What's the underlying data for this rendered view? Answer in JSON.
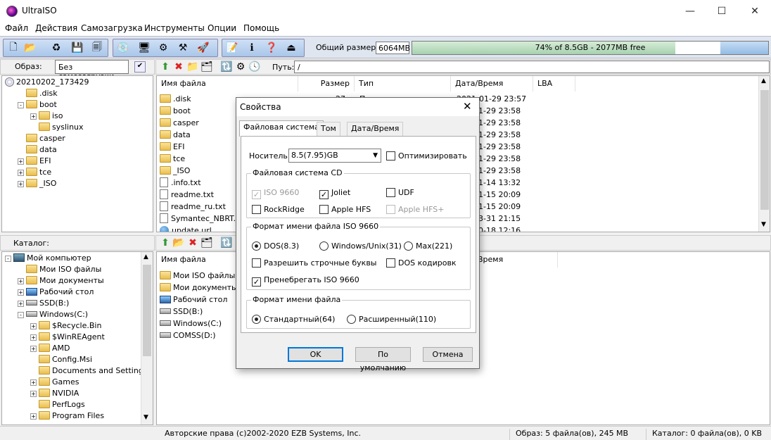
{
  "window": {
    "title": "UltraISO",
    "min": "—",
    "max": "☐",
    "close": "✕"
  },
  "menu": [
    "Файл",
    "Действия",
    "Самозагрузка",
    "Инструменты",
    "Опции",
    "Помощь"
  ],
  "toolbar": {
    "size_label": "Общий размер:",
    "size_value": "6064MB",
    "capacity_text": "74% of 8.5GB - 2077MB free",
    "used_fraction": 0.74
  },
  "image_panel": {
    "label": "Образ:",
    "boot_value": "Без самозагрузки",
    "path_label": "Путь:",
    "path_value": "/"
  },
  "image_tree": [
    {
      "label": "20210202_173429",
      "level": 0,
      "type": "disc"
    },
    {
      "label": ".disk",
      "level": 1,
      "type": "folder"
    },
    {
      "label": "boot",
      "level": 1,
      "type": "folder",
      "exp": "-"
    },
    {
      "label": "iso",
      "level": 2,
      "type": "folder",
      "exp": "+"
    },
    {
      "label": "syslinux",
      "level": 2,
      "type": "folder"
    },
    {
      "label": "casper",
      "level": 1,
      "type": "folder"
    },
    {
      "label": "data",
      "level": 1,
      "type": "folder"
    },
    {
      "label": "EFI",
      "level": 1,
      "type": "folder",
      "exp": "+"
    },
    {
      "label": "tce",
      "level": 1,
      "type": "folder",
      "exp": "+"
    },
    {
      "label": "_ISO",
      "level": 1,
      "type": "folder",
      "exp": "+"
    }
  ],
  "file_columns": {
    "name": "Имя файла",
    "size": "Размер",
    "type": "Тип",
    "date": "Дата/Время",
    "lba": "LBA"
  },
  "files": [
    {
      "name": ".disk",
      "size": "27",
      "type": "П",
      "date": "2021-01-29 23:57",
      "icon": "folder"
    },
    {
      "name": "boot",
      "date": "1-29 23:58",
      "icon": "folder"
    },
    {
      "name": "casper",
      "date": "1-29 23:58",
      "icon": "folder"
    },
    {
      "name": "data",
      "date": "1-29 23:58",
      "icon": "folder"
    },
    {
      "name": "EFI",
      "date": "1-29 23:58",
      "icon": "folder"
    },
    {
      "name": "tce",
      "date": "1-29 23:58",
      "icon": "folder"
    },
    {
      "name": "_ISO",
      "date": "1-29 23:58",
      "icon": "folder"
    },
    {
      "name": ".info.txt",
      "date": "1-14 13:32",
      "icon": "file"
    },
    {
      "name": "readme.txt",
      "date": "1-15 20:09",
      "icon": "file"
    },
    {
      "name": "readme_ru.txt",
      "date": "1-15 20:09",
      "icon": "file"
    },
    {
      "name": "Symantec_NBRT.in",
      "date": "3-31 21:15",
      "icon": "file"
    },
    {
      "name": "update.url",
      "date": "0-18 12:16",
      "icon": "globe"
    }
  ],
  "catalog_panel": {
    "label": "Каталог:"
  },
  "catalog_tree": [
    {
      "label": "Мой компьютер",
      "level": 0,
      "type": "pc",
      "exp": "-"
    },
    {
      "label": "Мои ISO файлы",
      "level": 1,
      "type": "folder"
    },
    {
      "label": "Мои документы",
      "level": 1,
      "type": "folder",
      "exp": "+"
    },
    {
      "label": "Рабочий стол",
      "level": 1,
      "type": "desk",
      "exp": "+"
    },
    {
      "label": "SSD(B:)",
      "level": 1,
      "type": "drive",
      "exp": "+"
    },
    {
      "label": "Windows(C:)",
      "level": 1,
      "type": "drive",
      "exp": "-"
    },
    {
      "label": "$Recycle.Bin",
      "level": 2,
      "type": "folder",
      "exp": "+"
    },
    {
      "label": "$WinREAgent",
      "level": 2,
      "type": "folder",
      "exp": "+"
    },
    {
      "label": "AMD",
      "level": 2,
      "type": "folder",
      "exp": "+"
    },
    {
      "label": "Config.Msi",
      "level": 2,
      "type": "folder"
    },
    {
      "label": "Documents and Settings",
      "level": 2,
      "type": "folder"
    },
    {
      "label": "Games",
      "level": 2,
      "type": "folder",
      "exp": "+"
    },
    {
      "label": "NVIDIA",
      "level": 2,
      "type": "folder",
      "exp": "+"
    },
    {
      "label": "PerfLogs",
      "level": 2,
      "type": "folder"
    },
    {
      "label": "Program Files",
      "level": 2,
      "type": "folder",
      "exp": "+"
    }
  ],
  "catalog_columns": {
    "name": "Имя файла",
    "date": "Время"
  },
  "catalog_files": [
    {
      "name": "Мои ISO файлы",
      "icon": "folder"
    },
    {
      "name": "Мои документы",
      "icon": "folder"
    },
    {
      "name": "Рабочий стол",
      "icon": "desk"
    },
    {
      "name": "SSD(B:)",
      "icon": "drive"
    },
    {
      "name": "Windows(C:)",
      "icon": "drive"
    },
    {
      "name": "COMSS(D:)",
      "icon": "drive"
    }
  ],
  "status": {
    "copyright": "Авторские права (c)2002-2020 EZB Systems, Inc.",
    "image": "Образ: 5 файла(ов), 245 MB",
    "catalog": "Каталог: 0 файла(ов), 0 KB"
  },
  "dialog": {
    "title": "Свойства",
    "tabs": [
      "Файловая система",
      "Том",
      "Дата/Время"
    ],
    "media_label": "Носитель:",
    "media_value": "8.5(7.95)GB",
    "optimize": "Оптимизировать",
    "cd_group": "Файловая система CD",
    "cd_options": [
      "ISO 9660",
      "Joliet",
      "UDF",
      "RockRidge",
      "Apple HFS",
      "Apple HFS+"
    ],
    "iso_group": "Формат имени файла ISO 9660",
    "iso_radios": [
      "DOS(8.3)",
      "Windows/Unix(31)",
      "Max(221)"
    ],
    "iso_checks": [
      "Разрешить строчные буквы",
      "DOS кодировк",
      "Пренебрегать ISO 9660"
    ],
    "name_group": "Формат имени файла",
    "name_radios": [
      "Стандартный(64)",
      "Расширенный(110)"
    ],
    "ok": "OK",
    "default": "По умолчанию",
    "cancel": "Отмена"
  }
}
